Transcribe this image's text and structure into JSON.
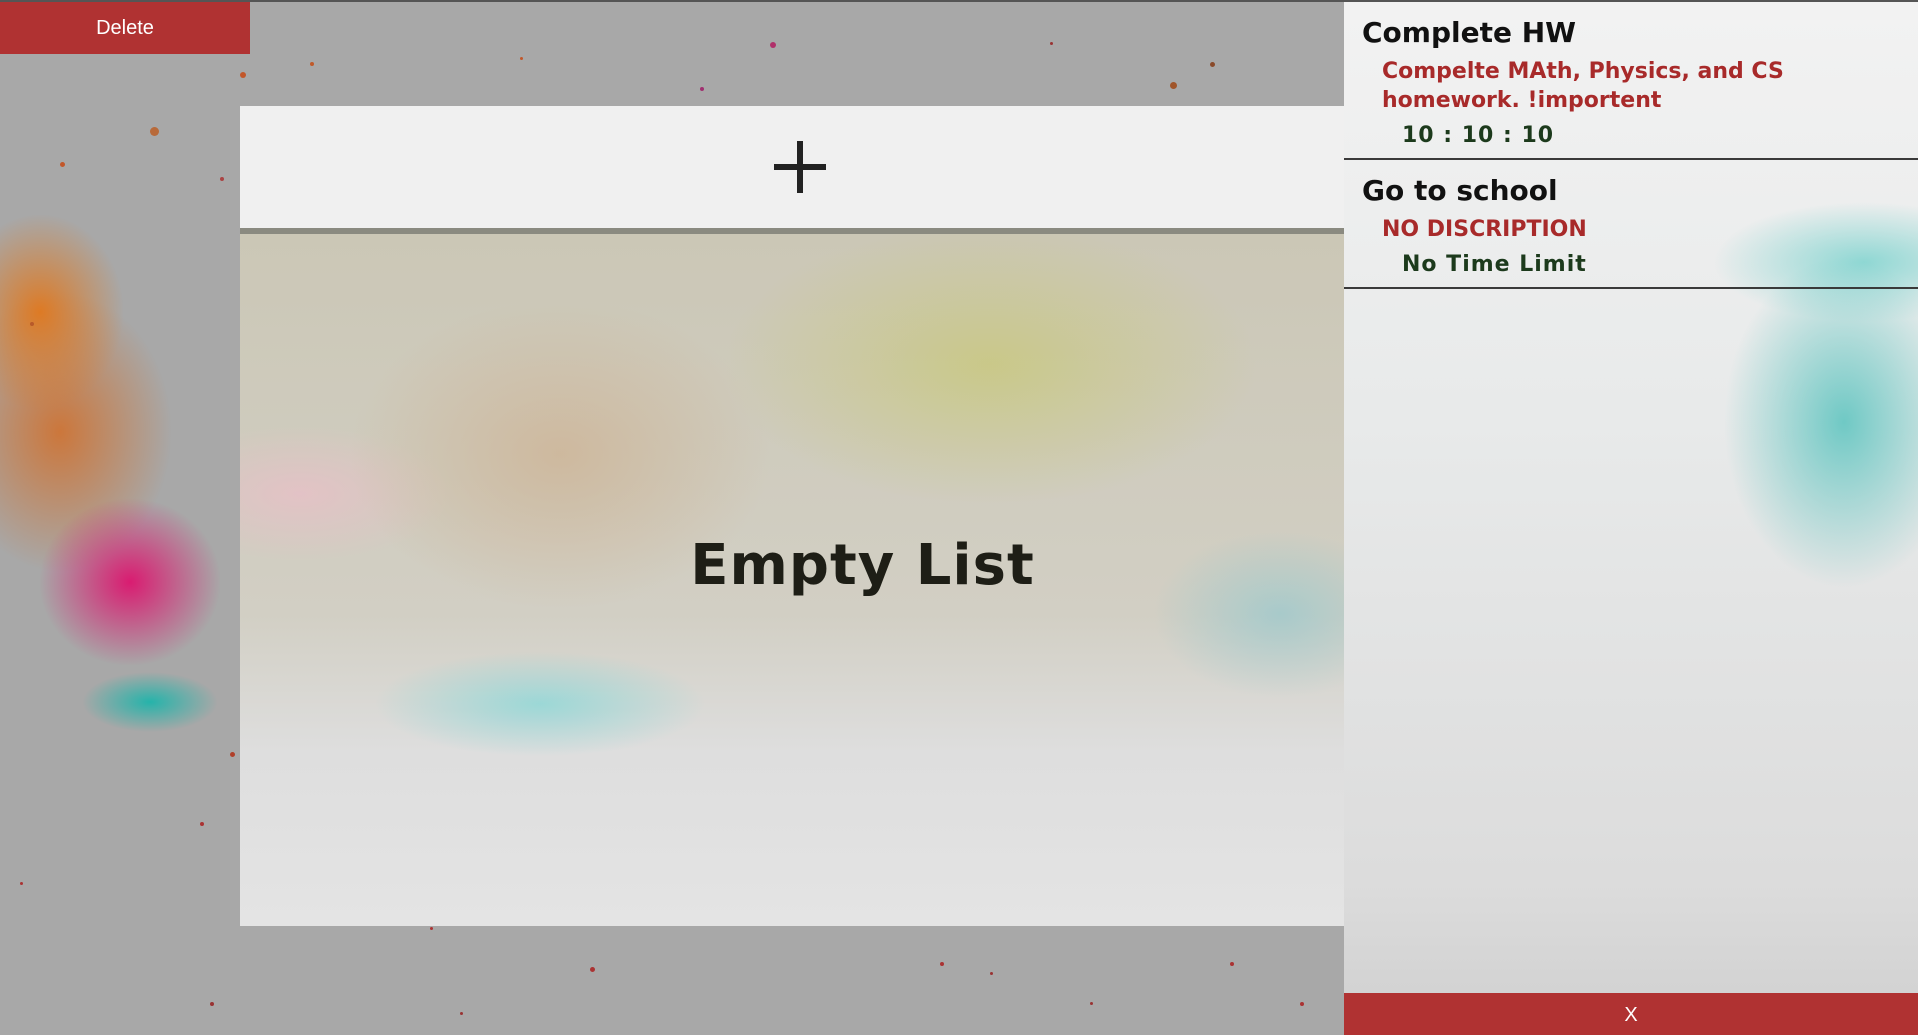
{
  "toolbar": {
    "delete_label": "Delete"
  },
  "main": {
    "add_icon": "plus-icon",
    "empty_text": "Empty List"
  },
  "sidebar": {
    "tasks": [
      {
        "title": "Complete HW",
        "description": "Compelte MAth, Physics, and CS homework. !importent",
        "time": "10 : 10 : 10"
      },
      {
        "title": "Go to school",
        "description": "NO DISCRIPTION",
        "time": "No Time Limit"
      }
    ],
    "close_label": "X"
  },
  "colors": {
    "accent_red": "#b03232",
    "description_red": "#a82a2a",
    "time_green": "#1c3a1c"
  }
}
